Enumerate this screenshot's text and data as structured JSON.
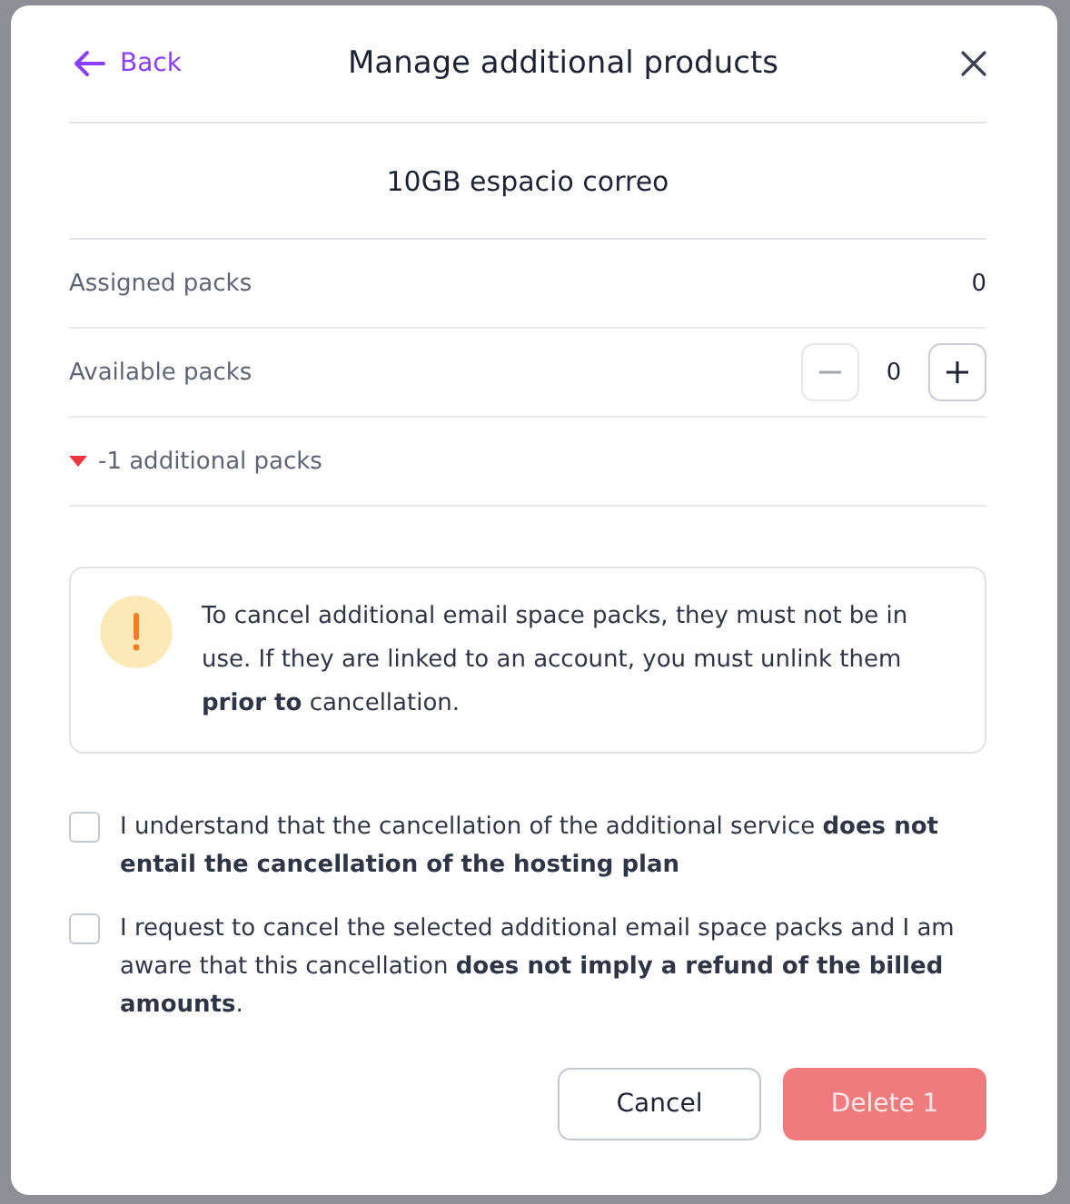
{
  "header": {
    "back_label": "Back",
    "title": "Manage additional products"
  },
  "product": {
    "name": "10GB espacio correo"
  },
  "rows": [
    {
      "kind": "value",
      "label": "Assigned packs",
      "value": "0"
    },
    {
      "kind": "stepper",
      "label": "Available packs",
      "value": "0",
      "minus_disabled": true,
      "plus_disabled": false
    }
  ],
  "change": {
    "text": "-1 additional packs",
    "decrease": true
  },
  "warning": {
    "text": "To cancel additional email space packs, they must not be in use. If they are linked to an account, you must unlink them **prior to** cancellation."
  },
  "checkboxes": [
    {
      "text": "I understand that the cancellation of the additional service **does not entail the cancellation of the hosting plan**",
      "checked": false
    },
    {
      "text": "I request to cancel the selected additional email space packs and I am aware that this cancellation **does not imply a refund of the billed amounts**.",
      "checked": false
    }
  ],
  "buttons": {
    "cancel": "Cancel",
    "delete": {
      "label": "Delete 1",
      "disabled": true
    }
  }
}
